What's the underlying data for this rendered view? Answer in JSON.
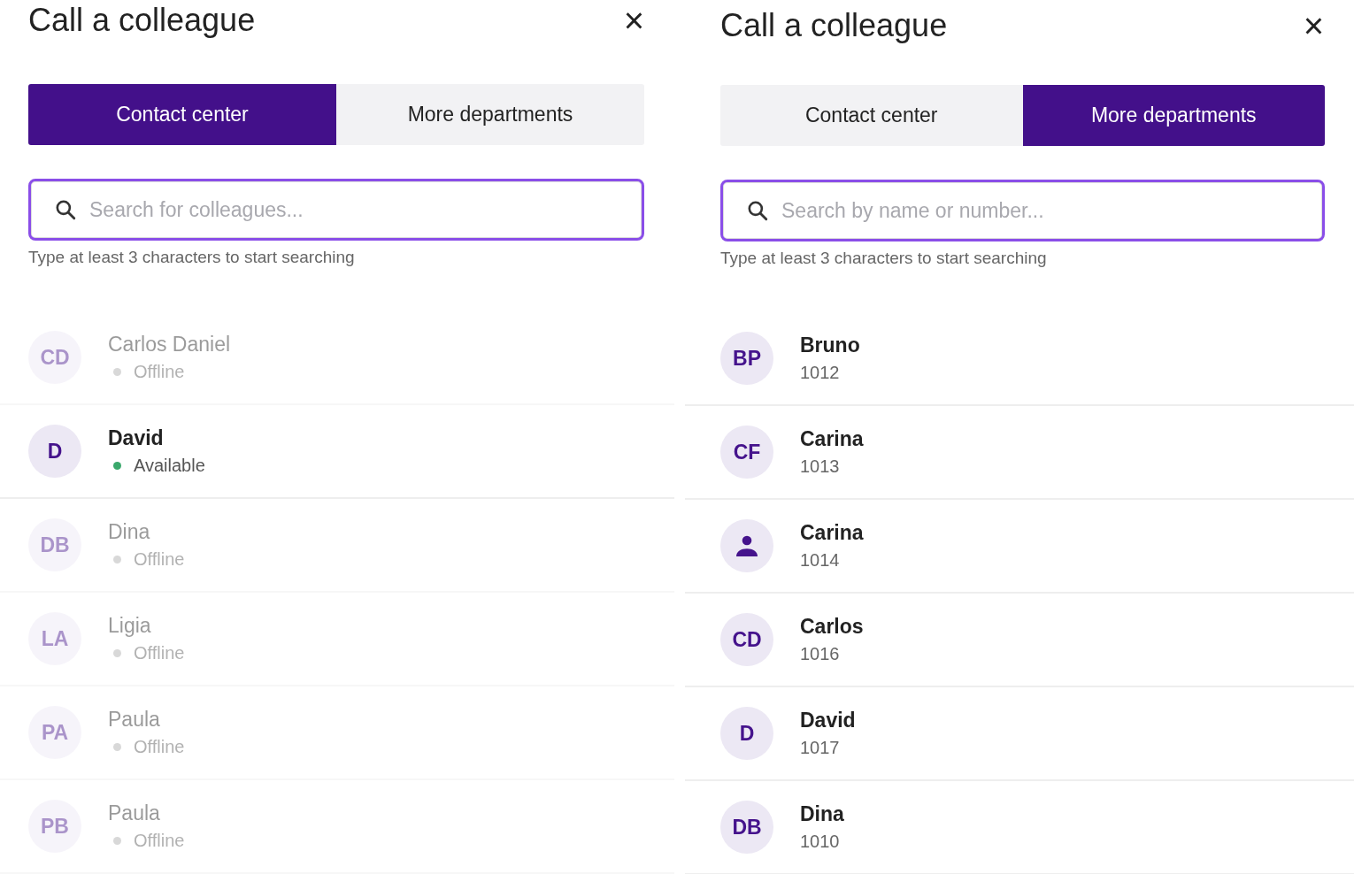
{
  "panels": [
    {
      "title": "Call a colleague",
      "close": "×",
      "tabs": [
        {
          "label": "Contact center",
          "selected": true
        },
        {
          "label": "More departments",
          "selected": false
        }
      ],
      "search": {
        "placeholder": "Search for colleagues...",
        "focused": true
      },
      "hint": "Type at least 3 characters to start searching",
      "contacts": [
        {
          "kind": "status",
          "avatar": {
            "kind": "initials",
            "text": "CD"
          },
          "name": "Carlos Daniel",
          "detail": "Offline",
          "online": false
        },
        {
          "kind": "status",
          "avatar": {
            "kind": "initials",
            "text": "D"
          },
          "name": "David",
          "detail": "Available",
          "online": true
        },
        {
          "kind": "status",
          "avatar": {
            "kind": "initials",
            "text": "DB"
          },
          "name": "Dina",
          "detail": "Offline",
          "online": false
        },
        {
          "kind": "status",
          "avatar": {
            "kind": "initials",
            "text": "LA"
          },
          "name": "Ligia",
          "detail": "Offline",
          "online": false
        },
        {
          "kind": "status",
          "avatar": {
            "kind": "initials",
            "text": "PA"
          },
          "name": "Paula",
          "detail": "Offline",
          "online": false
        },
        {
          "kind": "status",
          "avatar": {
            "kind": "initials",
            "text": "PB"
          },
          "name": "Paula",
          "detail": "Offline",
          "online": false
        }
      ]
    },
    {
      "title": "Call a colleague",
      "close": "×",
      "tabs": [
        {
          "label": "Contact center",
          "selected": false
        },
        {
          "label": "More departments",
          "selected": true
        }
      ],
      "search": {
        "placeholder": "Search by name or number...",
        "focused": true
      },
      "hint": "Type at least 3 characters to start searching",
      "contacts": [
        {
          "kind": "number",
          "avatar": {
            "kind": "initials",
            "text": "BP"
          },
          "name": "Bruno",
          "detail": "1012"
        },
        {
          "kind": "number",
          "avatar": {
            "kind": "initials",
            "text": "CF"
          },
          "name": "Carina",
          "detail": "1013"
        },
        {
          "kind": "number",
          "avatar": {
            "kind": "person"
          },
          "name": "Carina",
          "detail": "1014"
        },
        {
          "kind": "number",
          "avatar": {
            "kind": "initials",
            "text": "CD"
          },
          "name": "Carlos",
          "detail": "1016"
        },
        {
          "kind": "number",
          "avatar": {
            "kind": "initials",
            "text": "D"
          },
          "name": "David",
          "detail": "1017"
        },
        {
          "kind": "number",
          "avatar": {
            "kind": "initials",
            "text": "DB"
          },
          "name": "Dina",
          "detail": "1010"
        }
      ]
    }
  ]
}
